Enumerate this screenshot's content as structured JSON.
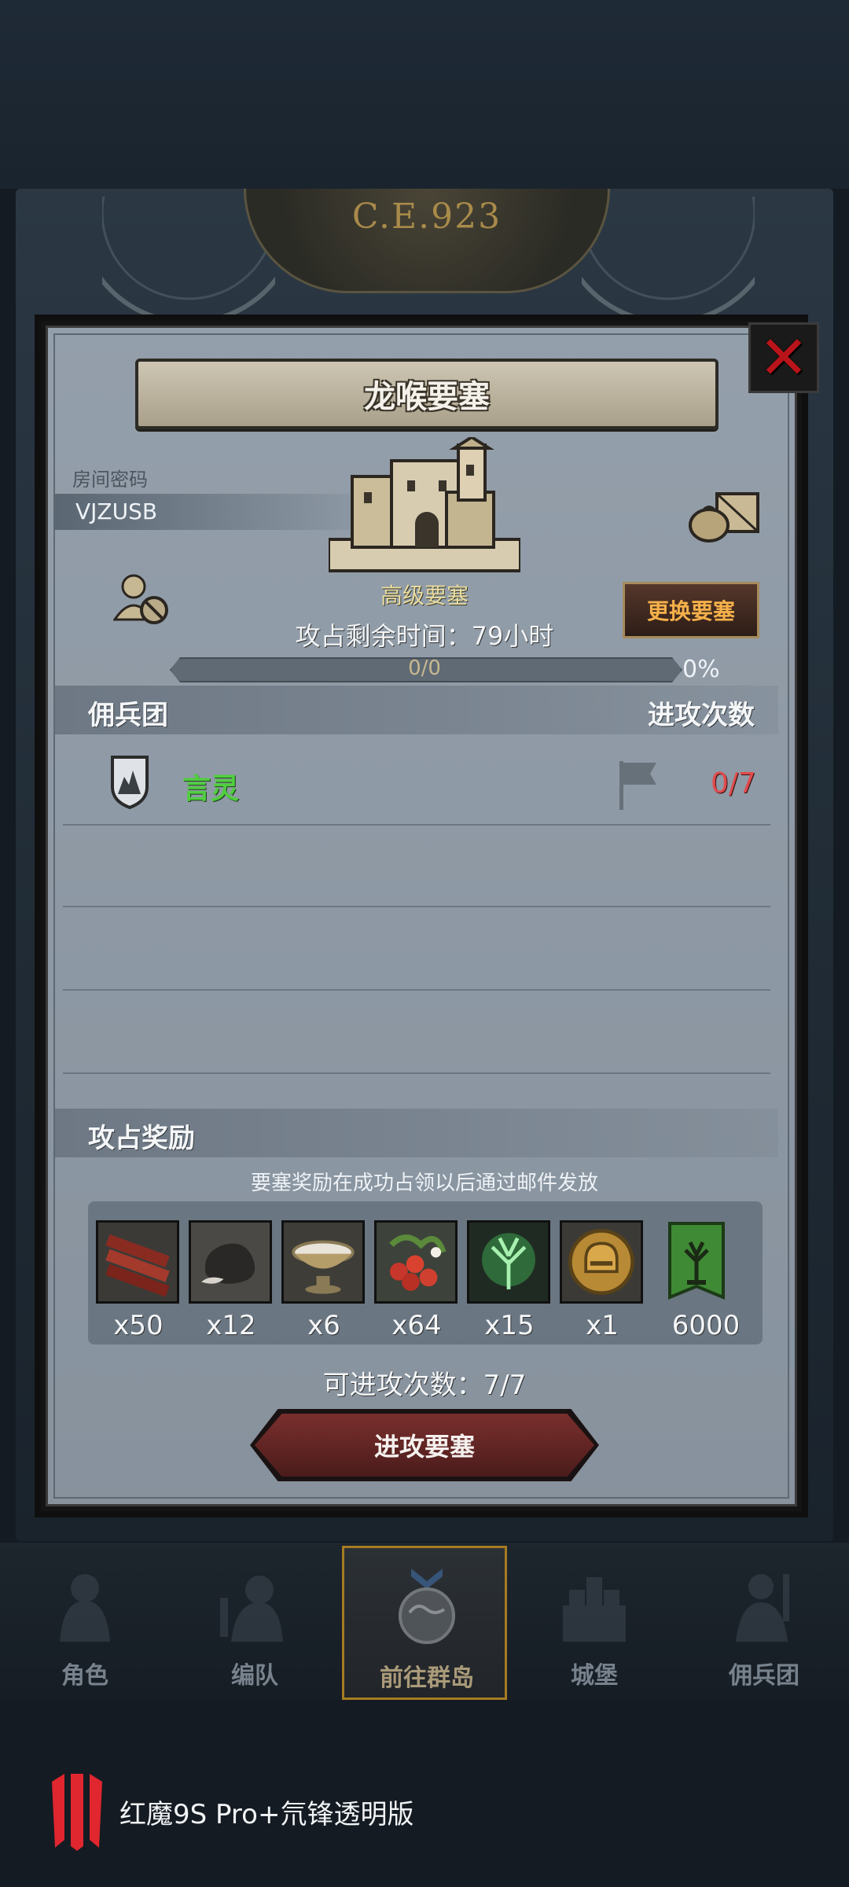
{
  "header": {
    "era": "C.E.923"
  },
  "dialog": {
    "title": "龙喉要塞",
    "room_label": "房间密码",
    "room_code": "VJZUSB",
    "fortress_grade": "高级要塞",
    "change_button": "更换要塞",
    "time_remaining": "攻占剩余时间：79小时",
    "progress": {
      "text": "0/0",
      "percent_label": "0%",
      "value": 0
    },
    "mercenary_section": {
      "title": "佣兵团",
      "right_title": "进攻次数"
    },
    "guilds": [
      {
        "name": "言灵",
        "attack_count": "0/7"
      }
    ],
    "reward_section": {
      "title": "攻占奖励",
      "note": "要塞奖励在成功占领以后通过邮件发放"
    },
    "rewards": [
      {
        "icon": "wood-planks-icon",
        "qty": "x50"
      },
      {
        "icon": "ore-rock-icon",
        "qty": "x12"
      },
      {
        "icon": "bowl-icon",
        "qty": "x6"
      },
      {
        "icon": "berries-icon",
        "qty": "x64"
      },
      {
        "icon": "spirit-tree-icon",
        "qty": "x15"
      },
      {
        "icon": "helmet-coin-icon",
        "qty": "x1"
      },
      {
        "icon": "tree-banner-icon",
        "qty": "6000"
      }
    ],
    "remaining_attacks": "可进攻次数：7/7",
    "attack_button": "进攻要塞"
  },
  "bottom_nav": [
    {
      "label": "角色",
      "icon": "knight-icon",
      "active": false
    },
    {
      "label": "编队",
      "icon": "formation-icon",
      "active": false
    },
    {
      "label": "前往群岛",
      "icon": "globe-icon",
      "active": true
    },
    {
      "label": "城堡",
      "icon": "castle-icon",
      "active": false
    },
    {
      "label": "佣兵团",
      "icon": "mercenary-icon",
      "active": false
    }
  ],
  "brand": {
    "text": "红魔9S Pro+氘锋透明版"
  },
  "colors": {
    "guild_name": "#4fcf3e",
    "attack_count": "#e24b4b",
    "change_button_text": "#f5b04a",
    "close_icon": "#b8141a",
    "brand_red": "#e0262e"
  }
}
